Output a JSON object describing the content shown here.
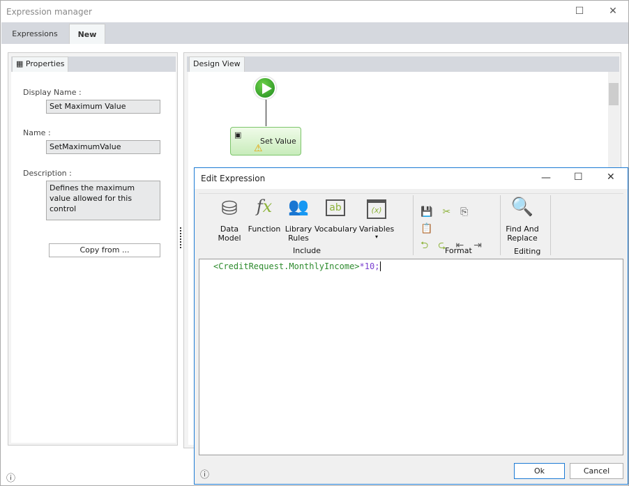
{
  "window": {
    "title": "Expression manager"
  },
  "tabs": [
    {
      "label": "Expressions"
    },
    {
      "label": "New",
      "active": true
    }
  ],
  "properties": {
    "tab": "Properties",
    "display_name_label": "Display Name :",
    "display_name": "Set Maximum Value",
    "name_label": "Name :",
    "name": "SetMaximumValue",
    "description_label": "Description :",
    "description": "Defines the maximum value allowed for this control",
    "copy_button": "Copy from ..."
  },
  "design_view": {
    "tab": "Design View",
    "node_label": "Set Value"
  },
  "dialog": {
    "title": "Edit Expression",
    "ribbon": {
      "include": {
        "label": "Include",
        "items": [
          {
            "l1": "Data",
            "l2": "Model"
          },
          {
            "l1": "Function",
            "l2": ""
          },
          {
            "l1": "Library",
            "l2": "Rules"
          },
          {
            "l1": "Vocabulary",
            "l2": ""
          },
          {
            "l1": "Variables",
            "l2": "▾"
          }
        ]
      },
      "format": {
        "label": "Format"
      },
      "editing": {
        "label": "Editing",
        "item_l1": "Find And",
        "item_l2": "Replace"
      }
    },
    "code": {
      "open": "<CreditRequest.MonthlyIncome>",
      "rest": "*10;"
    },
    "ok": "Ok",
    "cancel": "Cancel"
  },
  "colors": {
    "accent": "#1b7ad4",
    "green": "#8db33a",
    "code_ref": "#2e8b2e",
    "code_num": "#7a3fd0"
  }
}
